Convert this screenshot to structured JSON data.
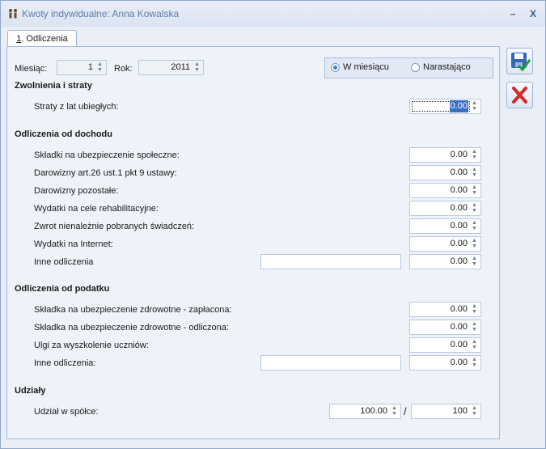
{
  "window": {
    "title": "Kwoty indywidualne: Anna Kowalska",
    "minimize": "–",
    "close": "X"
  },
  "tabs": [
    {
      "label": "1. Odliczenia",
      "hotkey": "1",
      "rest": ". Odliczenia"
    }
  ],
  "header": {
    "month_label": "Miesiąc:",
    "month_value": "1",
    "year_label": "Rok:",
    "year_value": "2011",
    "radio_monthly": "W miesiącu",
    "radio_cumulative": "Narastająco",
    "selected": "W miesiącu"
  },
  "sections": {
    "zwolnienia": {
      "title": "Zwolnienia i straty",
      "straty_label": "Straty z lat ubiegłych:",
      "straty_value": "0.00"
    },
    "dochod": {
      "title": "Odliczenia od dochodu",
      "rows": [
        {
          "label": "Składki na ubezpieczenie społeczne:",
          "value": "0.00"
        },
        {
          "label": "Darowizny art.26 ust.1 pkt 9 ustawy:",
          "value": "0.00"
        },
        {
          "label": "Darowizny pozostałe:",
          "value": "0.00"
        },
        {
          "label": "Wydatki na cele rehabilitacyjne:",
          "value": "0.00"
        },
        {
          "label": "Zwrot nienależnie pobranych świadczeń:",
          "value": "0.00"
        },
        {
          "label": "Wydatki na Internet:",
          "value": "0.00"
        },
        {
          "label": "Inne odliczenia",
          "value": "0.00",
          "text": ""
        }
      ]
    },
    "podatek": {
      "title": "Odliczenia od podatku",
      "rows": [
        {
          "label": "Składka na ubezpieczenie zdrowotne - zapłacona:",
          "value": "0.00"
        },
        {
          "label": "Składka na ubezpieczenie zdrowotne - odliczona:",
          "value": "0.00"
        },
        {
          "label": "Ulgi za wyszkolenie uczniów:",
          "value": "0.00"
        },
        {
          "label": "Inne odliczenia:",
          "value": "0.00",
          "text": ""
        }
      ]
    },
    "udzialy": {
      "title": "Udziały",
      "label": "Udział w spółce:",
      "numerator": "100.00",
      "separator": "/",
      "denominator": "100"
    }
  },
  "icons": {
    "save": "save-disk-icon",
    "cancel": "cancel-x-icon",
    "accent": "#3c7ad6",
    "cancel_color": "#d42a2a"
  }
}
